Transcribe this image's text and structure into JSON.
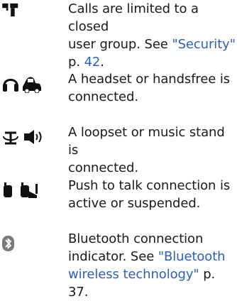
{
  "colors": {
    "text": "#1a1a1a",
    "link": "#2a5fc0"
  },
  "entries": [
    {
      "icons": [
        "closed-user-group-icon"
      ],
      "line1": "Calls are limited to a closed",
      "line2": "user group. See ",
      "line2_link": "\"Security\"",
      "line3_prefix": "p. ",
      "line3_link": "42",
      "line3_suffix": "."
    },
    {
      "icons": [
        "headset-icon",
        "handsfree-car-icon"
      ],
      "line1": "A headset or handsfree is",
      "line2": "connected."
    },
    {
      "icons": [
        "loopset-icon",
        "music-stand-speaker-icon"
      ],
      "line1": "A loopset or music stand is",
      "line2": "connected."
    },
    {
      "icons": [
        "push-to-talk-active-icon",
        "push-to-talk-suspended-icon"
      ],
      "line1": "Push to talk connection is",
      "line2": "active or suspended."
    },
    {
      "icons": [
        "bluetooth-icon"
      ],
      "line1": "Bluetooth connection",
      "line2_prefix": "indicator. See ",
      "line2_link": "\"Bluetooth",
      "line3_link": "wireless technology\"",
      "line3_prefix": " p. ",
      "line3_page": "37",
      "line3_suffix": "."
    }
  ]
}
